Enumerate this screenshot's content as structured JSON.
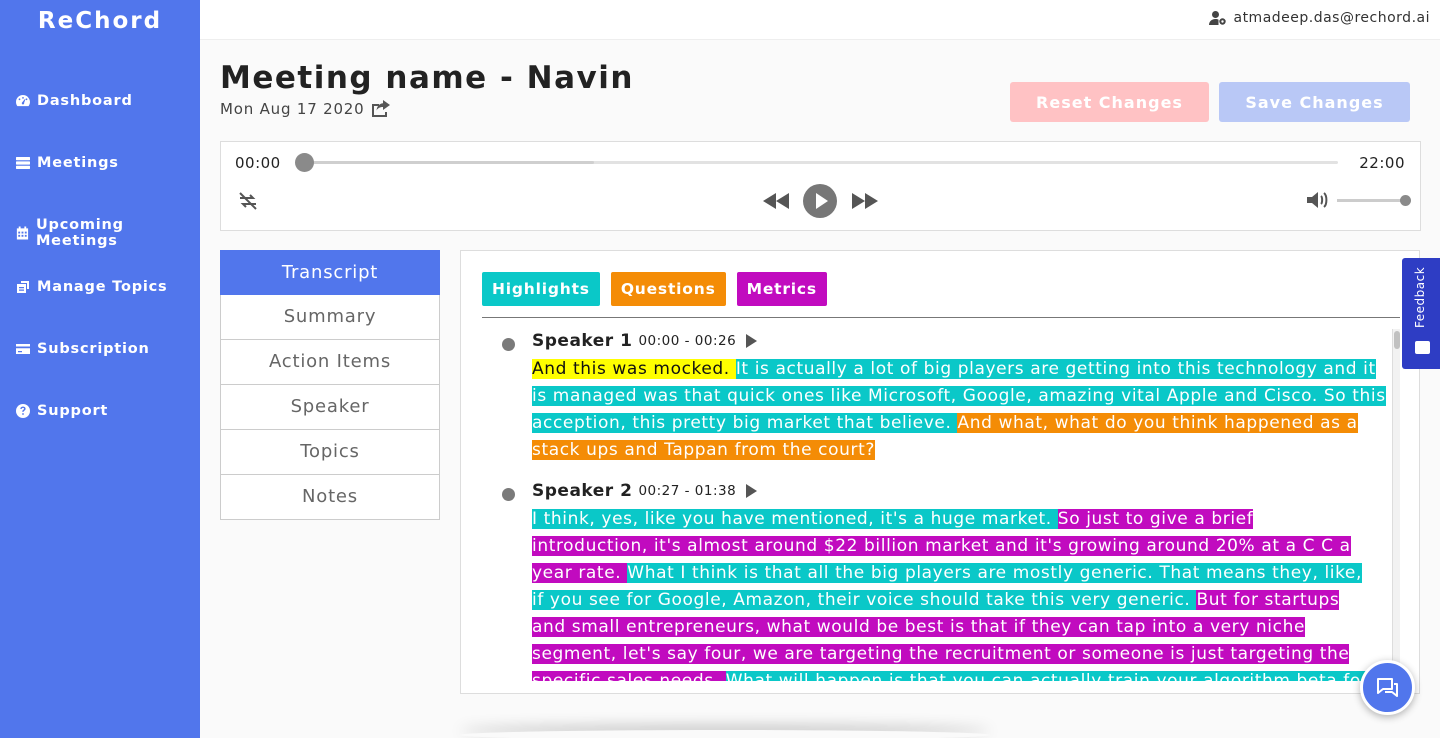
{
  "app": {
    "brand": "ReChord"
  },
  "sidebar": {
    "items": [
      {
        "label": "Dashboard",
        "icon": "dashboard-icon"
      },
      {
        "label": "Meetings",
        "icon": "list-icon"
      },
      {
        "label": "Upcoming Meetings",
        "icon": "calendar-icon"
      },
      {
        "label": "Manage Topics",
        "icon": "topics-icon"
      },
      {
        "label": "Subscription",
        "icon": "credit-card-icon"
      },
      {
        "label": "Support",
        "icon": "question-icon"
      }
    ]
  },
  "topbar": {
    "user_email": "atmadeep.das@rechord.ai",
    "user_icon": "user-cog-icon"
  },
  "header": {
    "title": "Meeting name - Navin",
    "date": "Mon Aug 17 2020",
    "share_icon": "share-icon",
    "reset_label": "Reset Changes",
    "save_label": "Save Changes"
  },
  "player": {
    "current_time": "00:00",
    "duration": "22:00",
    "progress": 0.0,
    "buffered": 0.28,
    "volume": 1.0,
    "icons": [
      "repeat-off-icon",
      "rewind-icon",
      "play-icon",
      "fast-forward-icon",
      "volume-icon"
    ]
  },
  "tabs": [
    {
      "label": "Transcript",
      "active": true
    },
    {
      "label": "Summary",
      "active": false
    },
    {
      "label": "Action Items",
      "active": false
    },
    {
      "label": "Speaker",
      "active": false
    },
    {
      "label": "Topics",
      "active": false
    },
    {
      "label": "Notes",
      "active": false
    }
  ],
  "filters": [
    {
      "label": "Highlights",
      "color": "#0ac8c8"
    },
    {
      "label": "Questions",
      "color": "#f48c06"
    },
    {
      "label": "Metrics",
      "color": "#c10bbf"
    }
  ],
  "colors": {
    "primary": "#5176ec",
    "highlight_yellow": "#ffff00",
    "highlight_cyan": "#0ac8c8",
    "question_orange": "#f48c06",
    "metric_magenta": "#c10bbf",
    "feedback_blue": "#2e3dc4"
  },
  "transcript": [
    {
      "speaker": "Speaker 1",
      "time": "00:00 - 00:26",
      "segments": [
        {
          "text": "And this was mocked. ",
          "type": "yellow"
        },
        {
          "text": "It is actually a lot of big players are getting into this technology and it is managed was that quick ones like Microsoft, Google, amazing vital Apple and Cisco. So this acception, this pretty big market that believe. ",
          "type": "cyan"
        },
        {
          "text": "And what, what do you think happened as a stack ups and Tappan from the court?",
          "type": "orange"
        }
      ]
    },
    {
      "speaker": "Speaker 2",
      "time": "00:27 - 01:38",
      "segments": [
        {
          "text": "I think, yes, like you have mentioned, it's a huge market. ",
          "type": "cyan"
        },
        {
          "text": "So just to give a brief introduction, it's almost around $22 billion market and it's growing around 20% at a C C a year rate. ",
          "type": "magenta"
        },
        {
          "text": "What I think is that all the big players are mostly generic. That means they, like, if you see for Google, Amazon, their voice should take this very generic. ",
          "type": "cyan"
        },
        {
          "text": "But for startups and small entrepreneurs, what would be best is that if they can tap into a very niche segment, let's say four, we are targeting the recruitment or someone is just targeting the specific sales needs. ",
          "type": "magenta"
        },
        {
          "text": "What will happen is that you can actually train your algorithm beta for that.",
          "type": "cyan"
        }
      ]
    }
  ],
  "feedback": {
    "label": "Feedback"
  },
  "chat": {
    "icon": "chat-icon"
  }
}
